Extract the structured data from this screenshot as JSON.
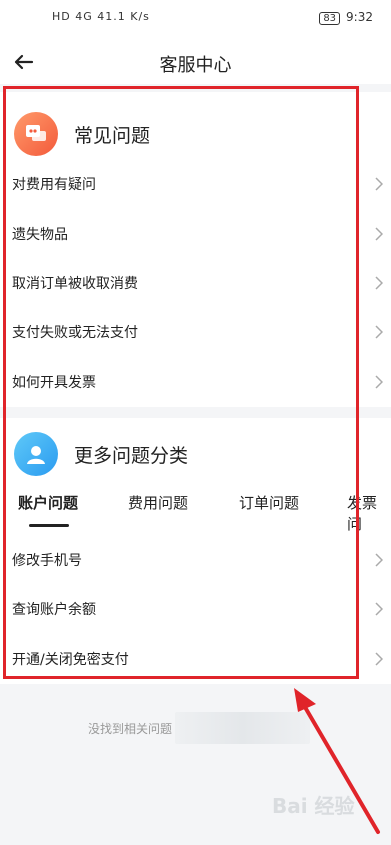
{
  "status_bar": {
    "left_text": "HD 4G 41.1 K/s",
    "time": "9:32",
    "battery": "83"
  },
  "nav": {
    "title": "客服中心"
  },
  "faq": {
    "title": "常见问题",
    "items": [
      {
        "label": "对费用有疑问"
      },
      {
        "label": "遗失物品"
      },
      {
        "label": "取消订单被收取消费"
      },
      {
        "label": "支付失败或无法支付"
      },
      {
        "label": "如何开具发票"
      }
    ]
  },
  "more": {
    "title": "更多问题分类",
    "tabs": [
      {
        "label": "账户问题"
      },
      {
        "label": "费用问题"
      },
      {
        "label": "订单问题"
      },
      {
        "label": "发票问"
      }
    ],
    "items": [
      {
        "label": "修改手机号"
      },
      {
        "label": "查询账户余额"
      },
      {
        "label": "开通/关闭免密支付"
      }
    ]
  },
  "footer": {
    "hint": "没找到相关问题"
  },
  "watermark": "Bai 经验",
  "colors": {
    "highlight": "#e0242a",
    "faq_icon": "#f35a3b",
    "more_icon": "#2a9bf0"
  }
}
